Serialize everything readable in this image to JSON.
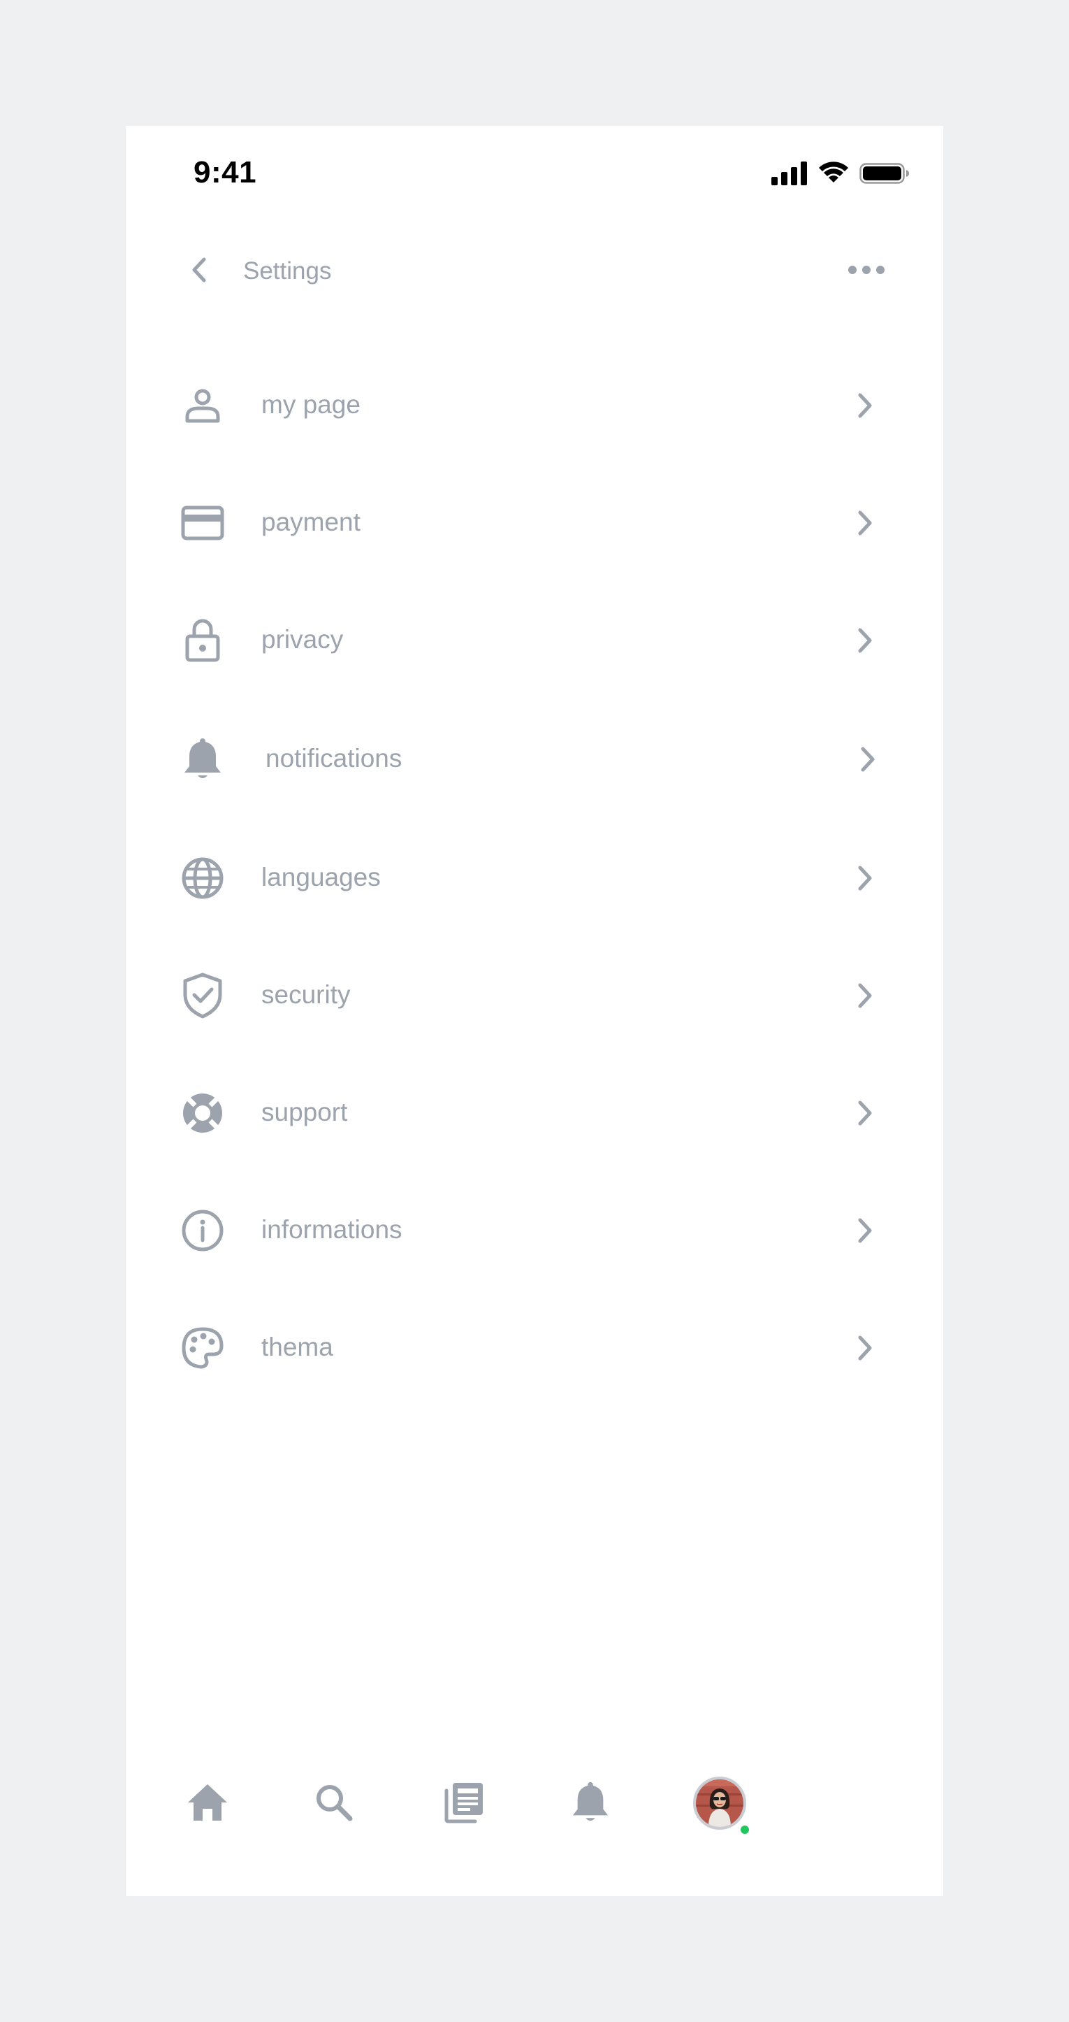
{
  "status_bar": {
    "time": "9:41",
    "icons": [
      "signal-icon",
      "wifi-icon",
      "battery-icon"
    ]
  },
  "header": {
    "back_icon": "chevron-left-icon",
    "title": "Settings",
    "more_icon": "ellipsis-icon"
  },
  "menu": {
    "items": [
      {
        "label": "my page",
        "icon": "user-icon"
      },
      {
        "label": "payment",
        "icon": "credit-card-icon"
      },
      {
        "label": "privacy",
        "icon": "lock-icon"
      },
      {
        "label": "notifications",
        "icon": "bell-icon"
      },
      {
        "label": "languages",
        "icon": "globe-icon"
      },
      {
        "label": "security",
        "icon": "shield-check-icon"
      },
      {
        "label": "support",
        "icon": "lifebuoy-icon"
      },
      {
        "label": "informations",
        "icon": "info-icon"
      },
      {
        "label": "thema",
        "icon": "palette-icon"
      }
    ]
  },
  "bottom_nav": {
    "items": [
      "home-icon",
      "search-icon",
      "news-icon",
      "bell-icon",
      "avatar"
    ]
  },
  "colors": {
    "text_muted": "#9ca3ad",
    "icon": "#9ca3ad",
    "background": "#ffffff",
    "page_background": "#eff0f2",
    "online": "#22c55e"
  }
}
